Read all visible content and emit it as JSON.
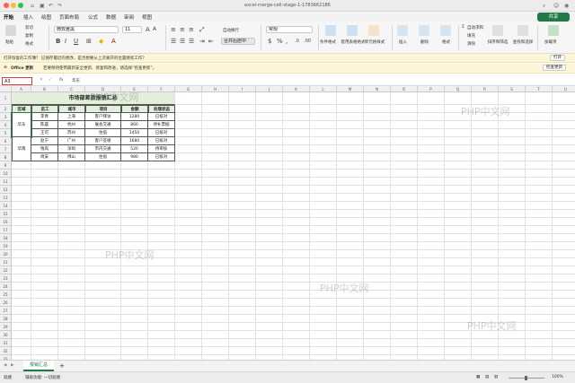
{
  "window": {
    "title": "excel-merge-cell-stage-1-1783662186"
  },
  "menu": {
    "items": [
      "开始",
      "插入",
      "绘图",
      "页面布局",
      "公式",
      "数据",
      "审阅",
      "视图"
    ],
    "share": "共享"
  },
  "ribbon": {
    "paste": "粘贴",
    "cut": "剪切",
    "copy": "复制",
    "format_painter": "格式",
    "font_name": "微软雅黑",
    "font_size": "11",
    "wrap_text": "自动换行",
    "merge_center": "合并后居中",
    "number_format": "常规",
    "conditional_format": "条件格式",
    "format_as_table": "套用表格格式",
    "cell_styles": "单元格样式",
    "insert": "插入",
    "delete": "删除",
    "format": "格式",
    "autosum": "自动求和",
    "fill": "填充",
    "clear": "清除",
    "sort_filter": "排序和筛选",
    "find_select": "查找和选择",
    "addins": "加载项"
  },
  "notice": {
    "text": "打开恢复的工作簿？ 已保存最近的更改，是否想要从上次离开的位置继续工作？",
    "button": "打开"
  },
  "update_notice": {
    "label": "Office 更新",
    "text": "若要保持使用最新安全更新、修复和改进，请选择“检查更新”。",
    "button": "检查更新"
  },
  "formula_bar": {
    "cell_ref": "A3",
    "fx": "fx",
    "value": "华东"
  },
  "sheet": {
    "columns": [
      "A",
      "B",
      "C",
      "D",
      "E",
      "F",
      "G",
      "H",
      "I",
      "J",
      "K",
      "L",
      "M",
      "N",
      "O",
      "P",
      "Q",
      "R",
      "S",
      "T",
      "U"
    ],
    "title": "市场部差旅报销汇总",
    "headers": [
      "区域",
      "员工",
      "城市",
      "项目",
      "金额",
      "处理状态"
    ],
    "rows": [
      [
        "华东",
        "李青",
        "上海",
        "客户拜访",
        "1280",
        "已核对"
      ],
      [
        "",
        "陈晨",
        "杭州",
        "展会交通",
        "860",
        "待补票据"
      ],
      [
        "",
        "王可",
        "苏州",
        "住宿",
        "1450",
        "已核对"
      ],
      [
        "华南",
        "赵宁",
        "广州",
        "客户答谢",
        "1680",
        "已核对"
      ],
      [
        "",
        "钱岚",
        "深圳",
        "市内交通",
        "520",
        "待审核"
      ],
      [
        "",
        "周安",
        "佛山",
        "住宿",
        "980",
        "已核对"
      ]
    ]
  },
  "tabs": {
    "sheet1": "报销汇总",
    "add": "+"
  },
  "status": {
    "ready": "就绪",
    "accessibility": "辅助功能: 一切就绪",
    "zoom": "100%"
  },
  "watermarks": [
    "PHP中文网",
    "PHP中文网",
    "PHP中文网",
    "PHP中文网",
    "PHP中文网"
  ]
}
